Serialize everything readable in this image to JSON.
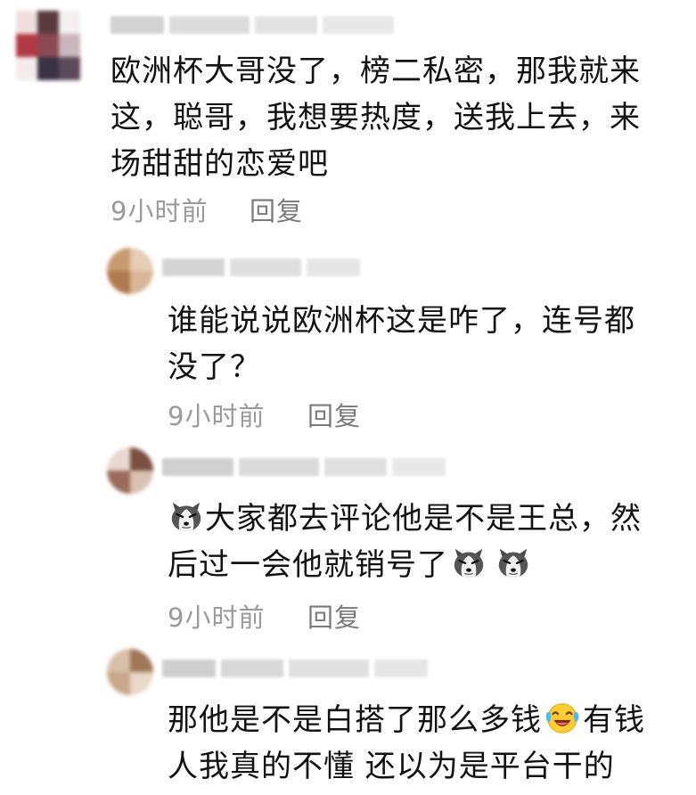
{
  "comments": [
    {
      "lines": [
        "欧洲杯大哥没了，榜二私密，那我就来",
        "这，聪哥，我想要热度，送我上去，来",
        "场甜甜的恋爱吧"
      ],
      "time": "9小时前",
      "reply_label": "回复"
    },
    {
      "lines": [
        "谁能说说欧洲杯这是咋了，连号都",
        "没了？"
      ],
      "time": "9小时前",
      "reply_label": "回复"
    },
    {
      "line1": "大家都去评论他是不是王总，然",
      "line2": "后过一会他就销号了",
      "emoji_icon": "husky-dog-emoji-icon",
      "time": "9小时前",
      "reply_label": "回复"
    },
    {
      "line1a": "那他是不是白搭了那么多钱",
      "line1b": "有钱",
      "line2": "人我真的不懂 还以为是平台干的",
      "emoji_icon": "laughing-tears-emoji-icon"
    }
  ],
  "colors": {
    "text": "#121212",
    "meta": "#9a9a9a",
    "reply": "#7a7a7a",
    "background": "#ffffff"
  }
}
